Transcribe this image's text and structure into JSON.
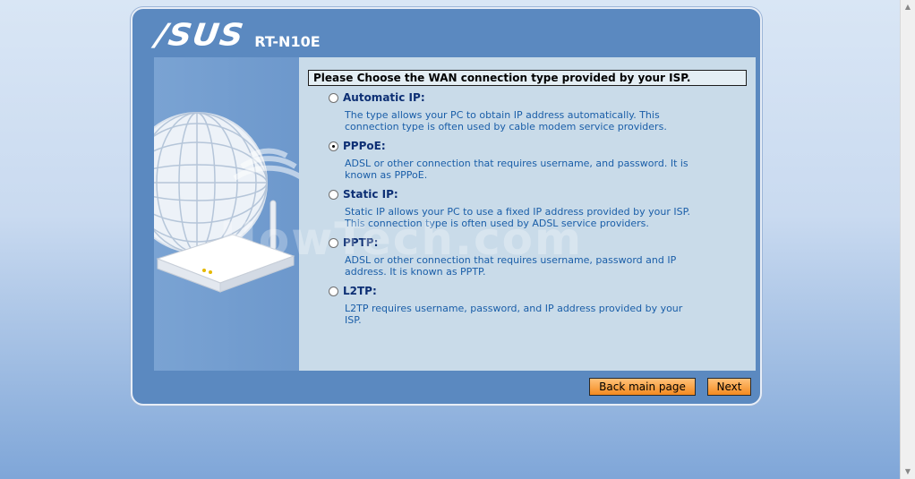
{
  "brand": {
    "logo": "/SUS",
    "model": "RT-N10E"
  },
  "wizard": {
    "heading": "Please Choose the WAN connection type provided by your ISP.",
    "options": [
      {
        "label": "Automatic IP:",
        "checked": false,
        "desc1": "The type allows your PC to obtain IP address automatically. This",
        "desc2": "connection type is often used by cable modem service providers."
      },
      {
        "label": "PPPoE:",
        "checked": true,
        "desc1": "ADSL or other connection that requires username, and password. It is",
        "desc2": "known as PPPoE."
      },
      {
        "label": "Static IP:",
        "checked": false,
        "desc1": "Static IP allows your PC to use a fixed IP address provided by your ISP.",
        "desc2": "This connection type is often used by ADSL service providers."
      },
      {
        "label": "PPTP:",
        "checked": false,
        "desc1": "ADSL or other connection that requires username, password and IP",
        "desc2": "address. It is known as PPTP."
      },
      {
        "label": "L2TP:",
        "checked": false,
        "desc1": "L2TP requires username, password, and IP address provided by your",
        "desc2": "ISP."
      }
    ]
  },
  "buttons": {
    "back": "Back main page",
    "next": "Next"
  },
  "watermark": "HowTech.com",
  "icons": {
    "globe": "globe-illustration-icon",
    "router": "router-illustration-icon",
    "signal": "wifi-signal-icon"
  }
}
